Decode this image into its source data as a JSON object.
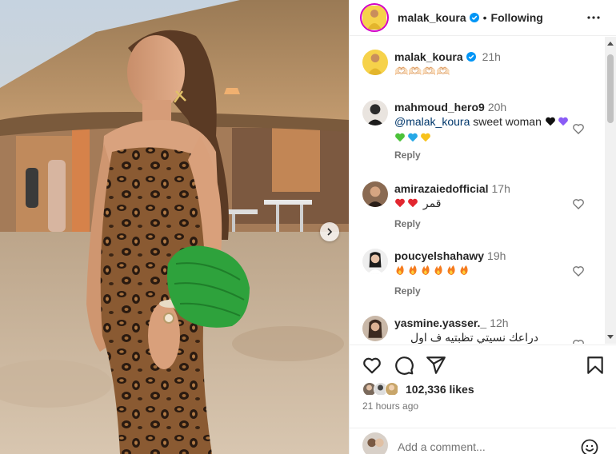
{
  "post": {
    "author": "malak_koura",
    "follow_status": "Following",
    "separator": "•",
    "caption": {
      "username": "malak_koura",
      "time": "21h",
      "text": "🫶🏻🫶🏻🫶🏻🫶🏻"
    }
  },
  "comments": [
    {
      "username": "mahmoud_hero9",
      "time": "20h",
      "mention": "@malak_koura",
      "text": " sweet woman ",
      "emojis_line1": [
        "black-heart",
        "purple-heart"
      ],
      "emojis_line2": [
        "green-heart",
        "blue-heart",
        "yellow-heart"
      ],
      "reply_label": "Reply"
    },
    {
      "username": "amirazaiedofficial",
      "time": "17h",
      "text": "قمر",
      "emojis": [
        "red-heart",
        "red-heart"
      ],
      "reply_label": "Reply"
    },
    {
      "username": "poucyelshahawy",
      "time": "19h",
      "emojis": [
        "fire",
        "fire",
        "fire",
        "fire",
        "fire",
        "fire"
      ],
      "reply_label": "Reply"
    },
    {
      "username": "yasmine.yasser._",
      "time": "12h",
      "text": "دراعك نسيتي تظبتيه ف اول صورة يا"
    }
  ],
  "actions": {
    "like_icon": "heart-icon",
    "comment_icon": "comment-icon",
    "share_icon": "share-icon",
    "save_icon": "bookmark-icon"
  },
  "likes": {
    "count_text": "102,336 likes"
  },
  "timestamp": "21 hours ago",
  "add_comment": {
    "placeholder": "Add a comment..."
  },
  "colors": {
    "accent_verified": "#0095f6",
    "text_primary": "#262626",
    "text_secondary": "#737373",
    "mention": "#00376b",
    "border": "#efefef"
  }
}
